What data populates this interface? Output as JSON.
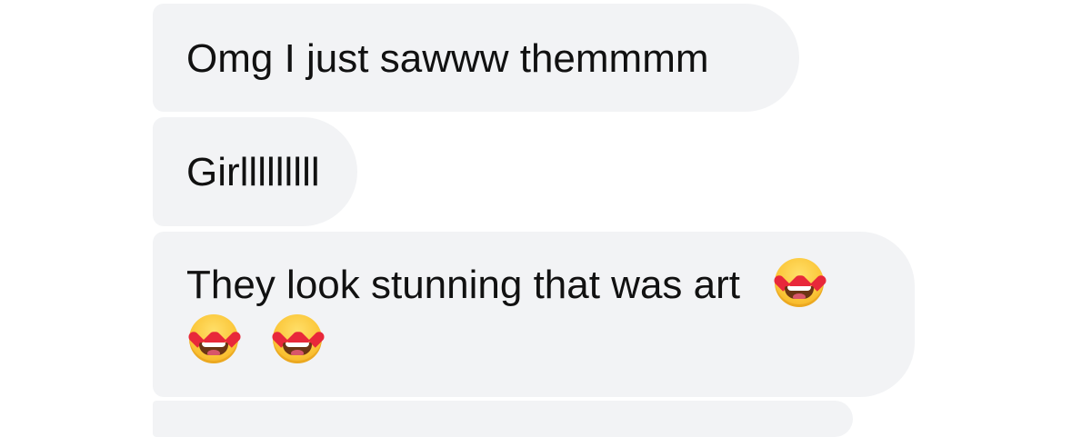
{
  "messages": [
    {
      "text": "Omg I just sawww themmmm"
    },
    {
      "text": "Girlllllllll"
    },
    {
      "text": "They look stunning that was art",
      "emoji": [
        "smiling-face-with-heart-eyes",
        "smiling-face-with-heart-eyes",
        "smiling-face-with-heart-eyes"
      ]
    }
  ],
  "colors": {
    "bubble_background": "#f2f3f5",
    "text": "#111111",
    "page_background": "#ffffff"
  }
}
